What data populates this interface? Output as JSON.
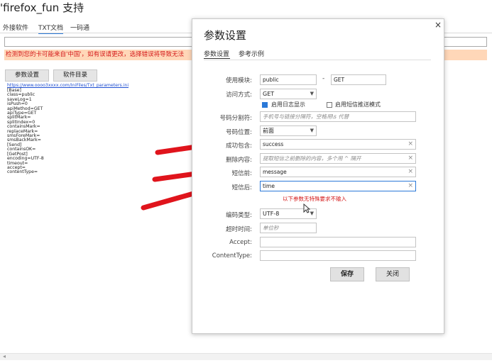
{
  "app": {
    "title": "'firefox_fun 支持"
  },
  "tabs": [
    "外接软件",
    "TXT文档",
    "一码通"
  ],
  "warning": "检测到您的卡可能来自'中国'，如有误请更改，选择错误将导致无法",
  "buttons": {
    "params": "参数设置",
    "software_dir": "软件目录"
  },
  "ini": {
    "link": "https://www.oooo3xxxx.com/IniFiles/Txt_parameters.ini",
    "lines": [
      "[Base]",
      "class=public",
      "saveLog=1",
      "isPush=0",
      "apiMethod=GET",
      "apiType=GET",
      "splitMark=",
      "splitIndex=0",
      "containsMark=",
      "replaceMark=",
      "smsForeMark=",
      "smsBackMark=",
      "[Send]",
      "containsOK=",
      "[GetPost]",
      "encoding=UTF-8",
      "timeout=",
      "accept=",
      "contentType="
    ]
  },
  "dialog": {
    "title": "参数设置",
    "tabs": [
      "参数设置",
      "参考示例"
    ],
    "fields": {
      "module": {
        "label": "使用模块:",
        "value": "public",
        "value2": "GET",
        "dash": "-"
      },
      "method": {
        "label": "访问方式:",
        "value": "GET"
      },
      "log_checkbox": "启用日志显示",
      "push_checkbox": "启用短信推送模式",
      "separator": {
        "label": "号码分割符:",
        "placeholder": "手机号与链接分隔符，空格用\\s 代替"
      },
      "position": {
        "label": "号码位置:",
        "value": "前面"
      },
      "success": {
        "label": "成功包含:",
        "value": "success"
      },
      "delete": {
        "label": "删除内容:",
        "placeholder": "提取短信之前删除的内容，多个用 ^ 隔开"
      },
      "sms_before": {
        "label": "短信前:",
        "value": "message"
      },
      "sms_after": {
        "label": "短信后:",
        "value": "time"
      },
      "note": "以下参数无特殊要求不输入",
      "encoding": {
        "label": "编码类型:",
        "value": "UTF-8"
      },
      "timeout": {
        "label": "超时时间:",
        "placeholder": "单位秒"
      },
      "accept": {
        "label": "Accept:"
      },
      "content_type": {
        "label": "ContentType:"
      }
    },
    "save": "保存",
    "close": "关闭",
    "close_glyph": "×",
    "clear_glyph": "×"
  },
  "colors": {
    "accent": "#2b79d8",
    "warning_bg": "#ffd7b8",
    "warning_text": "#d51b1b",
    "arrow": "#e0141c"
  }
}
